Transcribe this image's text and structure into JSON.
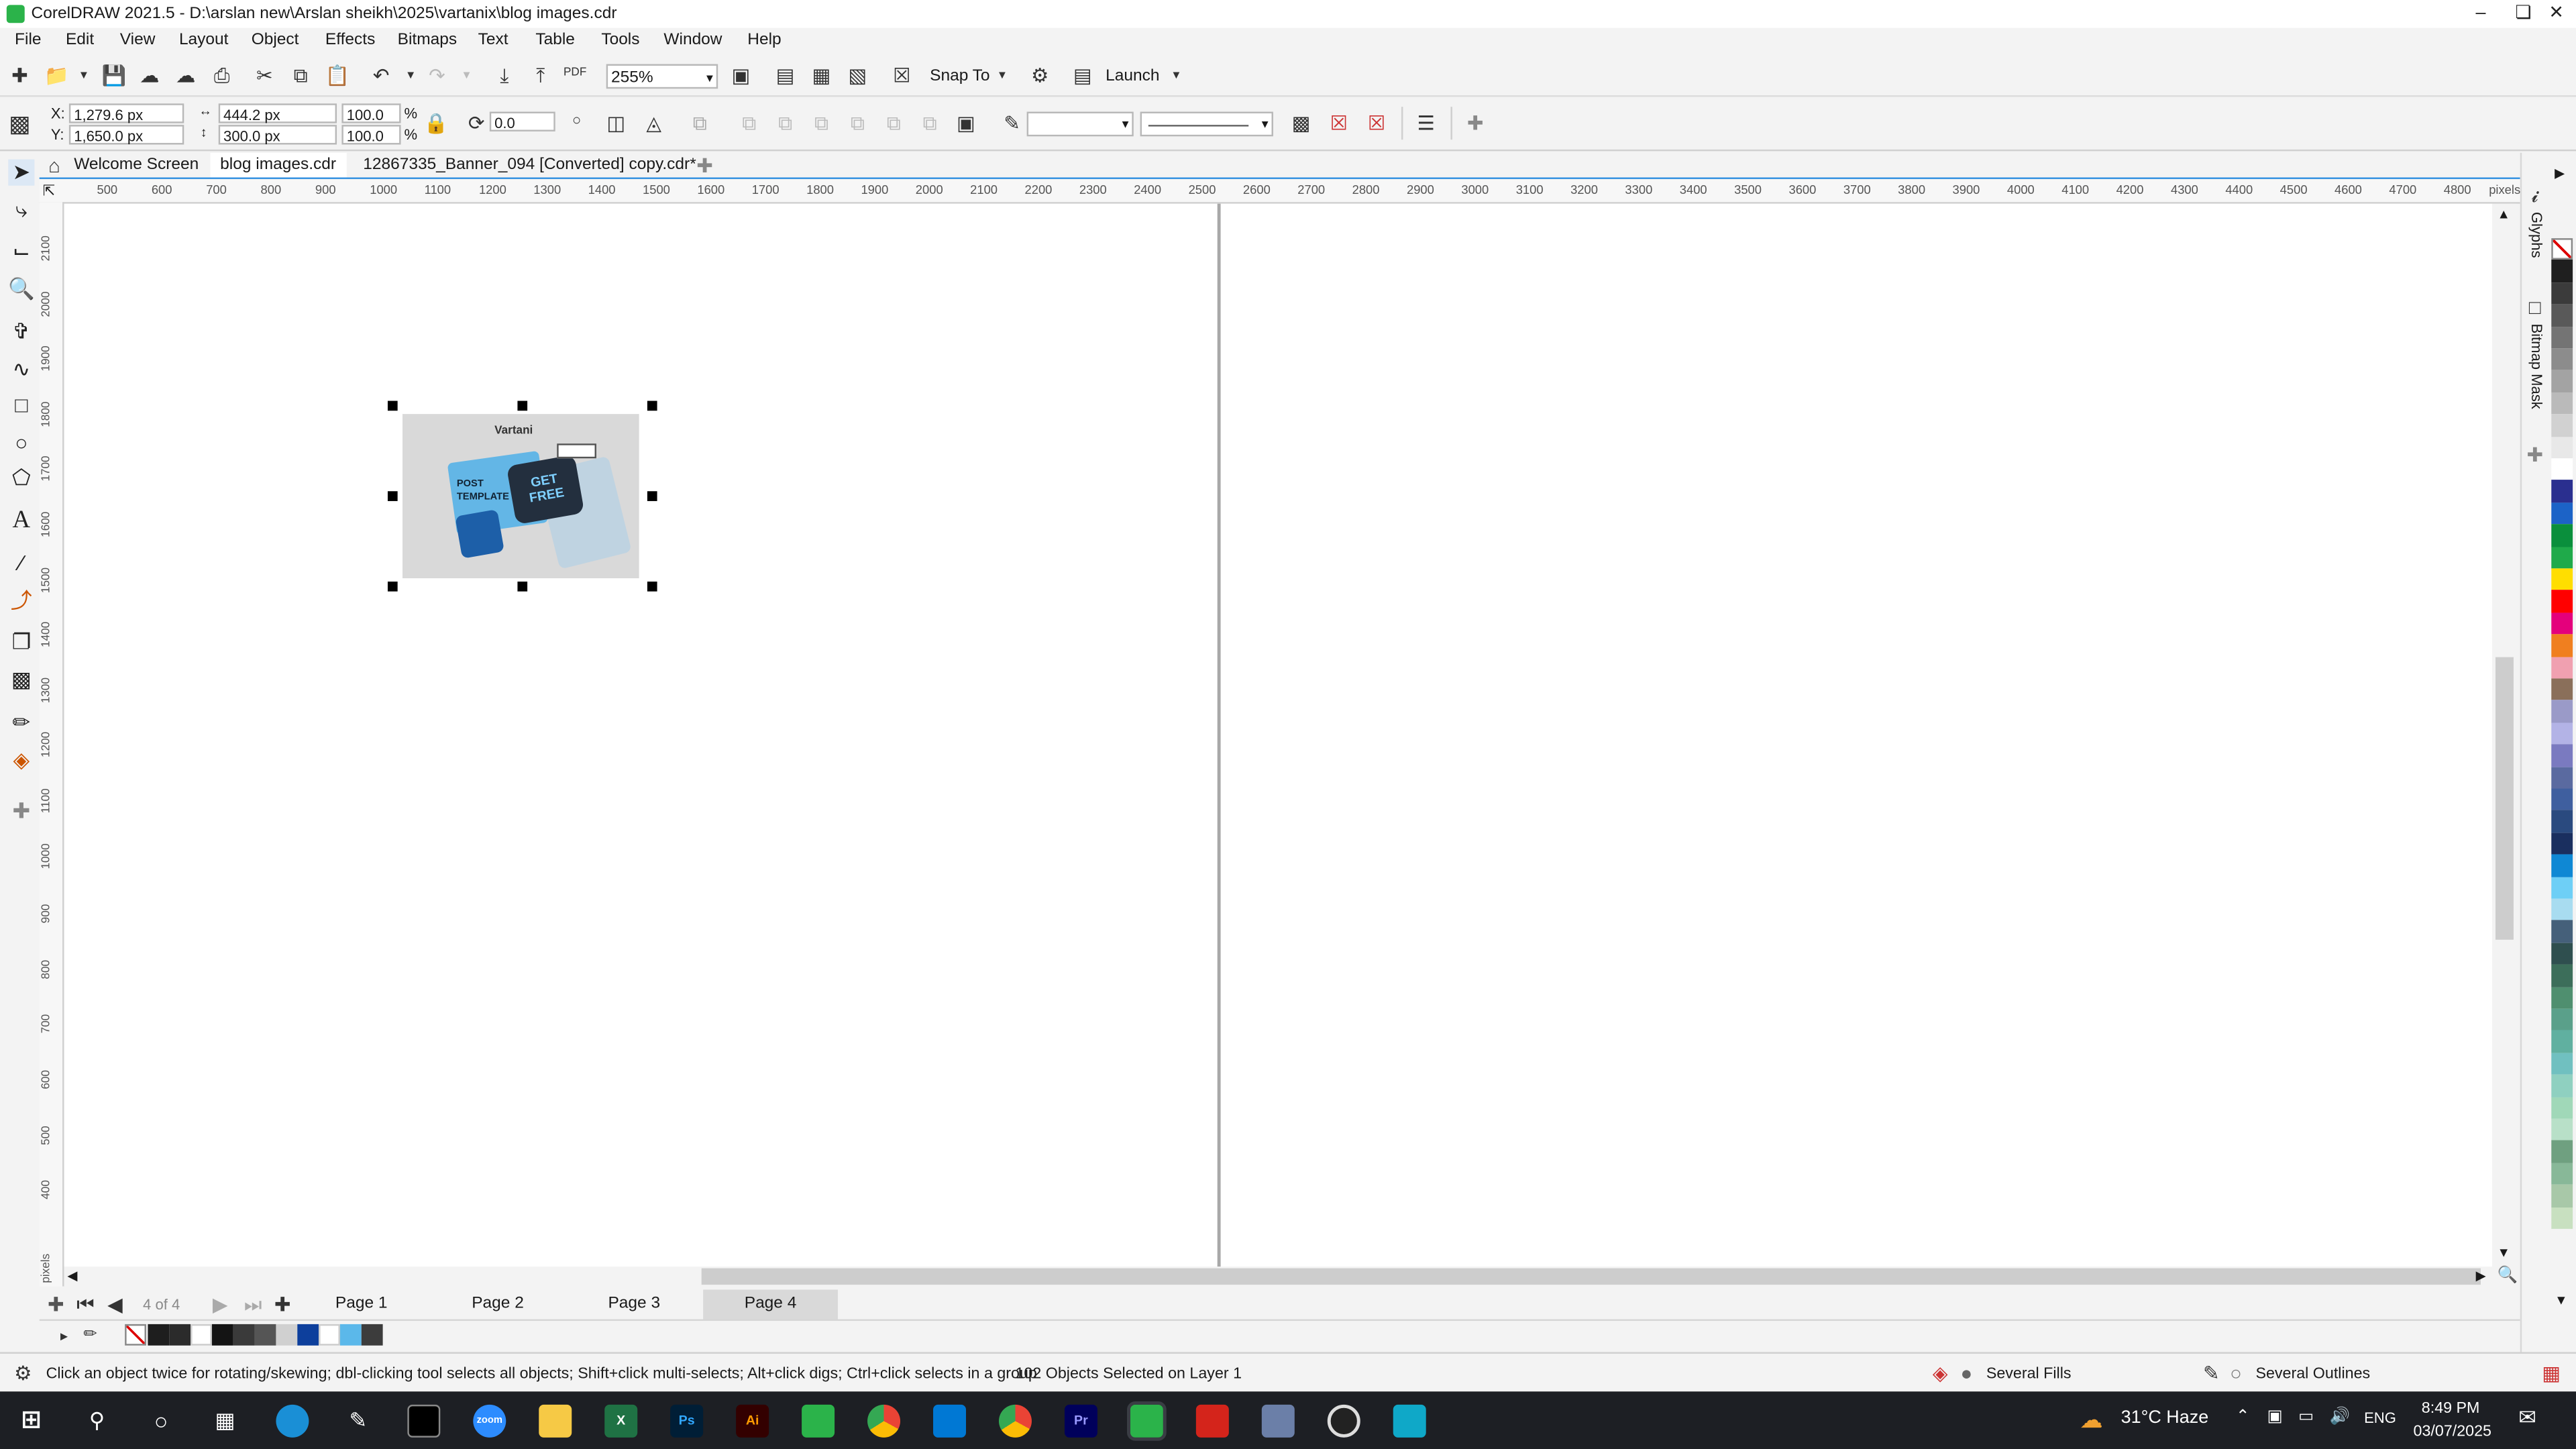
{
  "window": {
    "title": "CorelDRAW 2021.5 - D:\\arslan new\\Arslan sheikh\\2025\\vartanix\\blog images.cdr"
  },
  "menu": [
    "File",
    "Edit",
    "View",
    "Layout",
    "Object",
    "Effects",
    "Bitmaps",
    "Text",
    "Table",
    "Tools",
    "Window",
    "Help"
  ],
  "standard_toolbar": {
    "zoom": "255%",
    "snap_label": "Snap To",
    "launch_label": "Launch",
    "pdf_label": "PDF"
  },
  "property_bar": {
    "x_label": "X:",
    "x_value": "1,279.6 px",
    "y_label": "Y:",
    "y_value": "1,650.0 px",
    "w_value": "444.2 px",
    "h_value": "300.0 px",
    "scale_w": "100.0",
    "scale_h": "100.0",
    "pct": "%",
    "rotation": "0.0"
  },
  "tabs": [
    {
      "label": "Welcome Screen"
    },
    {
      "label": "blog images.cdr"
    },
    {
      "label": "12867335_Banner_094 [Converted] copy.cdr*"
    }
  ],
  "hruler": [
    "500",
    "600",
    "700",
    "800",
    "900",
    "1000",
    "1100",
    "1200",
    "1300",
    "1400",
    "1500",
    "1600",
    "1700",
    "1800",
    "1900",
    "2000",
    "2100",
    "2200",
    "2300",
    "2400",
    "2500",
    "2600",
    "2700",
    "2800",
    "2900",
    "3000",
    "3100",
    "3200",
    "3300",
    "3400",
    "3500",
    "3600",
    "3700",
    "3800",
    "3900",
    "4000",
    "4100",
    "4200",
    "4300",
    "4400",
    "4500",
    "4600",
    "4700",
    "4800"
  ],
  "hruler_unit": "pixels",
  "vruler": [
    "2100",
    "2000",
    "1900",
    "1800",
    "1700",
    "1600",
    "1500",
    "1400",
    "1300",
    "1200",
    "1100",
    "1000",
    "900",
    "800",
    "700",
    "600",
    "500",
    "400"
  ],
  "vruler_unit": "pixels",
  "artwork": {
    "brand": "Vartani",
    "line1": "POST",
    "line2": "TEMPLATE",
    "badge": "GET FREE"
  },
  "page_nav": {
    "counter": "4 of 4",
    "pages": [
      "Page 1",
      "Page 2",
      "Page 3",
      "Page 4"
    ]
  },
  "dockers": {
    "glyphs": "Glyphs",
    "bitmap_mask": "Bitmap Mask"
  },
  "status": {
    "hint": "Click an object twice for rotating/skewing; dbl-clicking tool selects all objects; Shift+click multi-selects; Alt+click digs; Ctrl+click selects in a group",
    "selection": "102 Objects Selected on Layer 1",
    "fill": "Several Fills",
    "outline": "Several Outlines"
  },
  "taskbar": {
    "weather": "31°C  Haze",
    "lang": "ENG",
    "time": "8:49 PM",
    "date": "03/07/2025",
    "zoom_app": "zoom",
    "ps": "Ps",
    "ai": "Ai",
    "pr": "Pr"
  },
  "colors": {
    "accent": "#2f8ee0",
    "brand_green": "#2bb34a"
  }
}
